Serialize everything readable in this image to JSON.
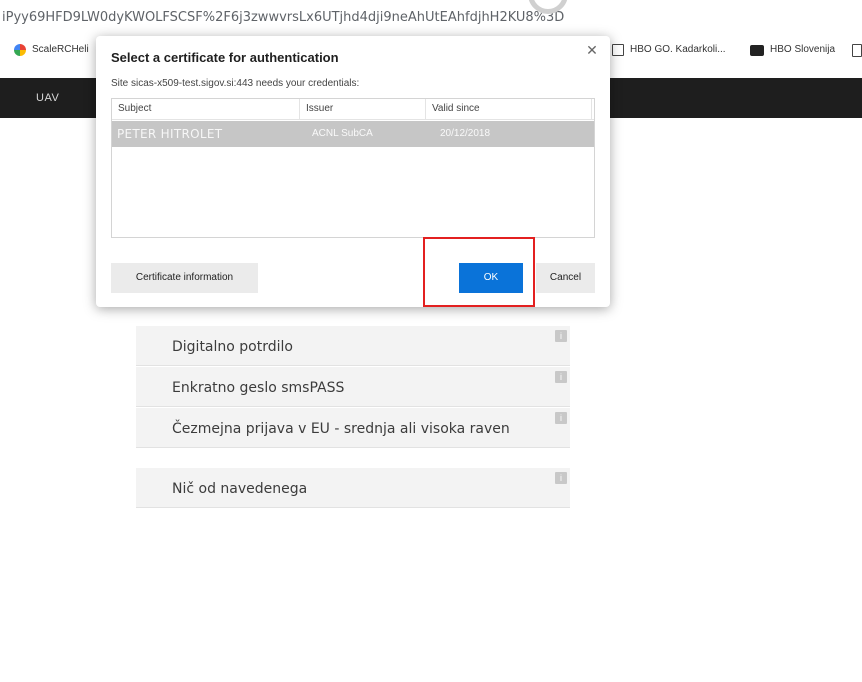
{
  "browser": {
    "url_fragment": "iPyy69HFD9LW0dyKWOLFSCSF%2F6j3zwwvrsLx6UTjhd4dji9neAhUtEAhfdjhH2KU8%3D",
    "bookmarks": [
      {
        "label": "ScaleRCHeli",
        "icon": "scalerc-favicon-icon"
      },
      {
        "label": "HBO GO. Kadarkoli...",
        "icon": "hbo-go-icon"
      },
      {
        "label": "HBO Slovenija",
        "icon": "hbo-slovenija-icon"
      }
    ]
  },
  "app_bar": {
    "label": "UAV"
  },
  "dialog": {
    "title": "Select a certificate for authentication",
    "subtitle": "Site sicas-x509-test.sigov.si:443 needs your credentials:",
    "close_glyph": "✕",
    "columns": [
      "Subject",
      "Issuer",
      "Valid since"
    ],
    "rows": [
      {
        "subject": "PETER HITROLET",
        "issuer": "ACNL SubCA",
        "valid_since": "20/12/2018"
      }
    ],
    "buttons": {
      "certificate_info": "Certificate information",
      "ok": "OK",
      "cancel": "Cancel"
    },
    "colors": {
      "ok": "#0a73d9",
      "highlight": "#e32020",
      "selected_row": "#c6c6c6"
    }
  },
  "login_options": [
    {
      "label": "Digitalno potrdilo",
      "info": "i"
    },
    {
      "label": "Enkratno geslo smsPASS",
      "info": "i"
    },
    {
      "label": "Čezmejna prijava v EU - srednja ali visoka raven",
      "info": "i"
    },
    {
      "label": "Nič od navedenega",
      "info": "i"
    }
  ]
}
